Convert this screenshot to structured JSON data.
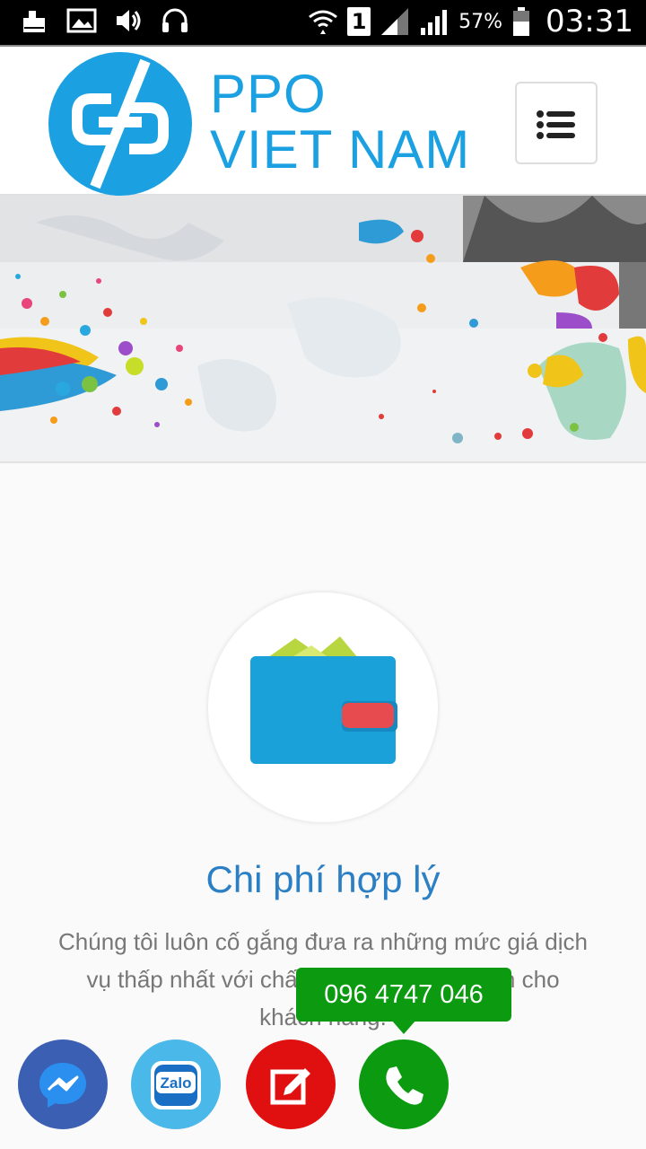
{
  "status_bar": {
    "sim_label": "1",
    "battery": "57%",
    "time": "03:31"
  },
  "header": {
    "logo_line1": "PPO",
    "logo_line2": "VIET NAM",
    "brand_color": "#1ba1e2"
  },
  "feature": {
    "title": "Chi phí hợp lý",
    "desc_line1": "Chúng tôi luôn cố gắng đưa ra những mức giá dịch",
    "desc_line2": "vụ thấp nhất với chất lượng tốt nhất dành cho",
    "desc_line3": "khách hàng.",
    "icon": "wallet-icon"
  },
  "contact": {
    "phone": "096 4747 046",
    "buttons": [
      "messenger-icon",
      "zalo-icon",
      "edit-form-icon",
      "phone-icon"
    ],
    "zalo_label": "Zalo"
  }
}
